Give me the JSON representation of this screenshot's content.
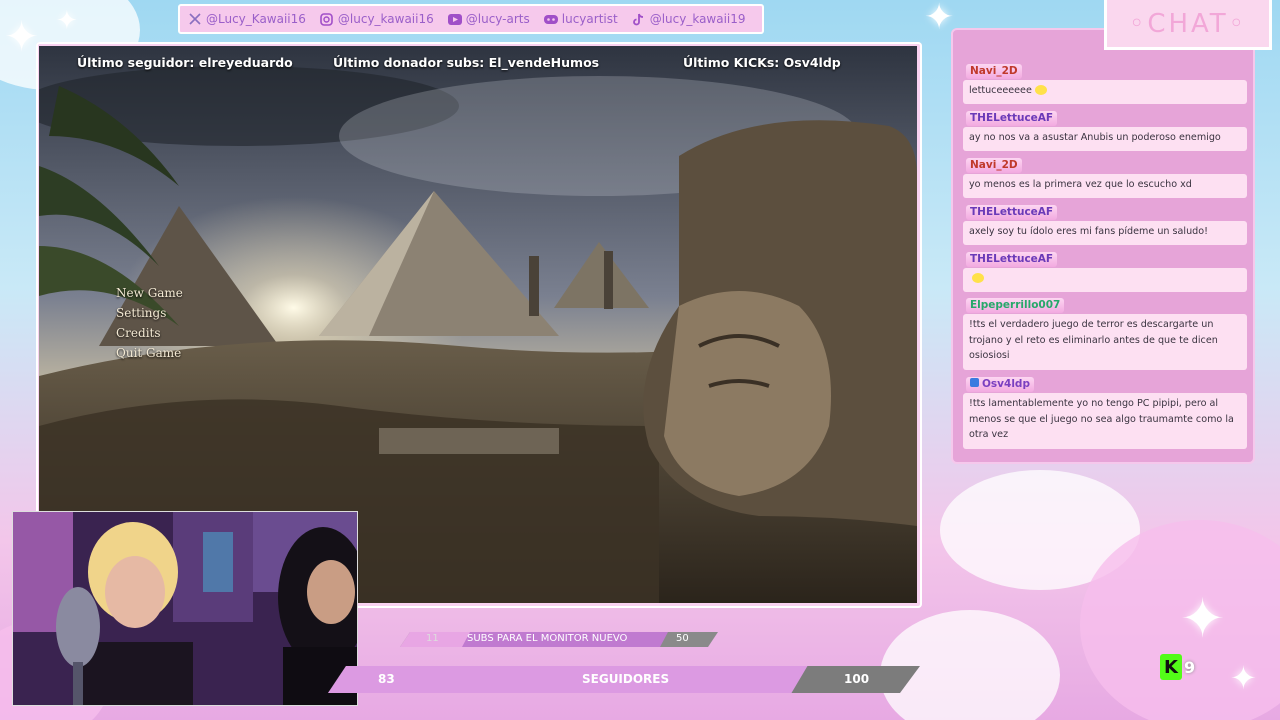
{
  "social": [
    {
      "icon": "x-twitter-icon",
      "handle": "@Lucy_Kawaii16"
    },
    {
      "icon": "instagram-icon",
      "handle": "@lucy_kawaii16"
    },
    {
      "icon": "youtube-icon",
      "handle": "@lucy-arts"
    },
    {
      "icon": "discord-icon",
      "handle": "lucyartist"
    },
    {
      "icon": "tiktok-icon",
      "handle": "@lucy_kawaii19"
    }
  ],
  "alerts": {
    "last_follower": "Último seguidor: elreyeduardo",
    "last_donor": "Último donador subs: El_vendeHumos",
    "last_kick": "Último KICKs: Osv4ldp"
  },
  "game_menu": [
    "New Game",
    "Settings",
    "Credits",
    "Quit Game"
  ],
  "sub_goal": {
    "current": "11",
    "label": "SUBS PARA EL MONITOR NUEVO",
    "target": "50",
    "progress": 0.22
  },
  "follower_goal": {
    "current": "83",
    "label": "SEGUIDORES",
    "target": "100",
    "progress": 0.83
  },
  "chat": {
    "title": "◦CHAT◦",
    "messages": [
      {
        "user": "Navi_2D",
        "user_color": "#c0392b",
        "text": "lettuceeeeee",
        "emote": true
      },
      {
        "user": "THELettuceAF",
        "user_color": "#6a3ab8",
        "text": "ay no nos va a asustar Anubis un poderoso enemigo",
        "emote": false
      },
      {
        "user": "Navi_2D",
        "user_color": "#c0392b",
        "text": "yo menos es la primera vez que lo escucho xd",
        "emote": false
      },
      {
        "user": "THELettuceAF",
        "user_color": "#6a3ab8",
        "text": "axely soy tu ídolo eres mi fans pídeme un saludo!",
        "emote": false
      },
      {
        "user": "THELettuceAF",
        "user_color": "#6a3ab8",
        "text": "",
        "emote": true
      },
      {
        "user": "Elpeperrillo007",
        "user_color": "#27a86a",
        "text": "!tts el verdadero juego de terror es descargarte un trojano y el reto es eliminarlo antes de que te dicen osiosiosi",
        "emote": false
      },
      {
        "user": "Osv4ldp",
        "user_color": "#7a3fc0",
        "text": "!tts lamentablemente yo no tengo PC pipipi, pero al menos se que el juego no sea algo traumamte como la otra vez",
        "emote": false
      }
    ]
  },
  "kick_badge": {
    "letter": "K",
    "count": "9"
  }
}
